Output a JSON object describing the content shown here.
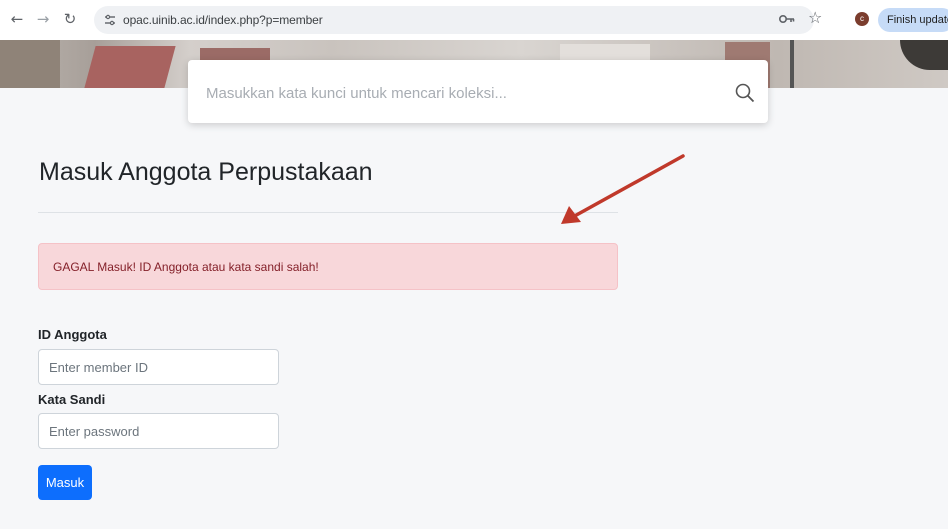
{
  "browser": {
    "url": "opac.uinib.ac.id/index.php?p=member",
    "back_icon": "back-arrow-icon",
    "forward_icon": "forward-arrow-icon",
    "reload_icon": "reload-icon",
    "profile_initial": "c",
    "update_label": "Finish update"
  },
  "search": {
    "placeholder": "Masukkan kata kunci untuk mencari koleksi..."
  },
  "page": {
    "title": "Masuk Anggota Perpustakaan",
    "alert_message": "GAGAL Masuk! ID Anggota atau kata sandi salah!"
  },
  "form": {
    "member_id_label": "ID Anggota",
    "member_id_placeholder": "Enter member ID",
    "password_label": "Kata Sandi",
    "password_placeholder": "Enter password",
    "submit_label": "Masuk"
  },
  "colors": {
    "alert_bg": "#f8d7da",
    "alert_text": "#842029",
    "button": "#0d6efd",
    "annotation_arrow": "#c0392b"
  }
}
